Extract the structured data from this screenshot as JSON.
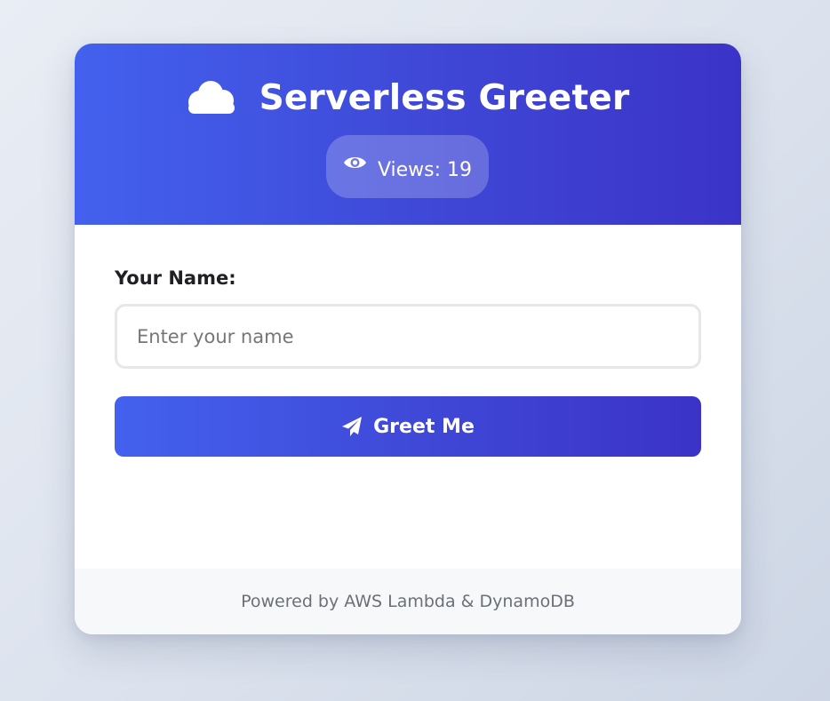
{
  "header": {
    "icon": "cloud-icon",
    "title": "Serverless Greeter",
    "views": {
      "icon": "eye-icon",
      "label": "Views:",
      "count": "19"
    }
  },
  "form": {
    "name_label": "Your Name:",
    "name_input": {
      "value": "",
      "placeholder": "Enter your name"
    },
    "greet_button": {
      "icon": "paper-plane-icon",
      "label": "Greet Me"
    }
  },
  "footer": {
    "text": "Powered by AWS Lambda & DynamoDB"
  },
  "colors": {
    "gradient_start": "#4361ee",
    "gradient_end": "#3b33c8",
    "footer_background": "#f7f8fa",
    "footer_text": "#6b7078"
  }
}
